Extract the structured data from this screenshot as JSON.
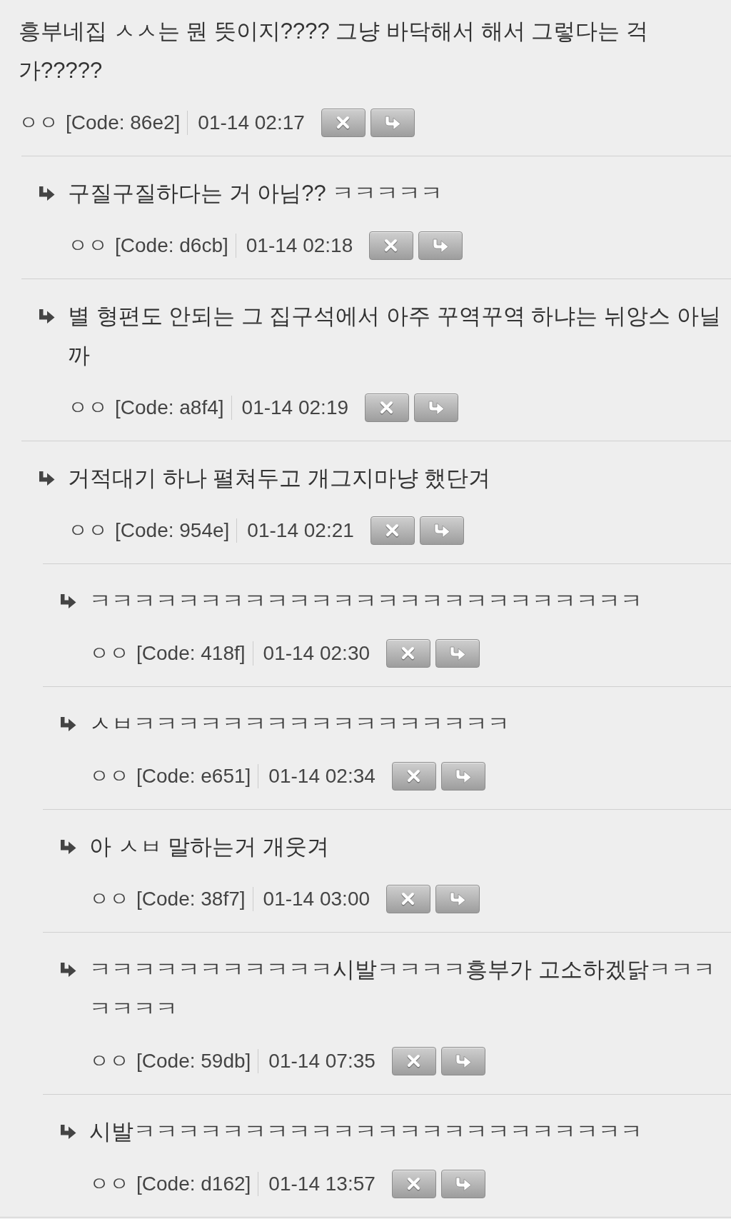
{
  "comments": [
    {
      "text": "흥부네집 ㅅㅅ는 뭔 뜻이지???? 그냥 바닥해서 해서 그렇다는 걱가?????",
      "author": "ㅇㅇ",
      "code": "[Code: 86e2]",
      "time": "01-14 02:17",
      "children": [
        {
          "text": "구질구질하다는 거 아님?? ㅋㅋㅋㅋㅋ",
          "author": "ㅇㅇ",
          "code": "[Code: d6cb]",
          "time": "01-14 02:18"
        },
        {
          "text": "별 형편도 안되는 그 집구석에서 아주 꾸역꾸역 하냐는 뉘앙스 아닐까",
          "author": "ㅇㅇ",
          "code": "[Code: a8f4]",
          "time": "01-14 02:19"
        },
        {
          "text": "거적대기 하나 펼쳐두고 개그지마냥 했단겨",
          "author": "ㅇㅇ",
          "code": "[Code: 954e]",
          "time": "01-14 02:21",
          "children": [
            {
              "text": "ㅋㅋㅋㅋㅋㅋㅋㅋㅋㅋㅋㅋㅋㅋㅋㅋㅋㅋㅋㅋㅋㅋㅋㅋㅋ",
              "author": "ㅇㅇ",
              "code": "[Code: 418f]",
              "time": "01-14 02:30"
            },
            {
              "text": "ㅅㅂㅋㅋㅋㅋㅋㅋㅋㅋㅋㅋㅋㅋㅋㅋㅋㅋㅋ",
              "author": "ㅇㅇ",
              "code": "[Code: e651]",
              "time": "01-14 02:34"
            },
            {
              "text": "아 ㅅㅂ 말하는거 개웃겨",
              "author": "ㅇㅇ",
              "code": "[Code: 38f7]",
              "time": "01-14 03:00"
            },
            {
              "text": "ㅋㅋㅋㅋㅋㅋㅋㅋㅋㅋㅋ시발ㅋㅋㅋㅋ흥부가 고소하겠닭ㅋㅋㅋㅋㅋㅋㅋ",
              "author": "ㅇㅇ",
              "code": "[Code: 59db]",
              "time": "01-14 07:35"
            },
            {
              "text": "시발ㅋㅋㅋㅋㅋㅋㅋㅋㅋㅋㅋㅋㅋㅋㅋㅋㅋㅋㅋㅋㅋㅋㅋ",
              "author": "ㅇㅇ",
              "code": "[Code: d162]",
              "time": "01-14 13:57"
            }
          ]
        }
      ]
    }
  ]
}
